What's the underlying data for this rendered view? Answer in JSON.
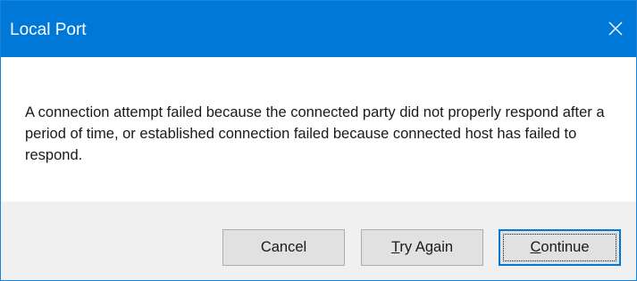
{
  "window": {
    "title": "Local Port",
    "close_icon": "close-icon"
  },
  "message": {
    "text": "A connection attempt failed because the connected party did not properly respond after a period of time, or established connection failed because connected host has failed to respond."
  },
  "buttons": {
    "cancel": "Cancel",
    "try_again": {
      "mnemonic": "T",
      "rest": "ry Again"
    },
    "continue": {
      "mnemonic": "C",
      "rest": "ontinue"
    }
  },
  "colors": {
    "titlebar": "#0078d7",
    "title_text": "#ffffff",
    "footer": "#f0f0f0",
    "button_face": "#e1e1e1",
    "default_button_border": "#0078d7"
  }
}
